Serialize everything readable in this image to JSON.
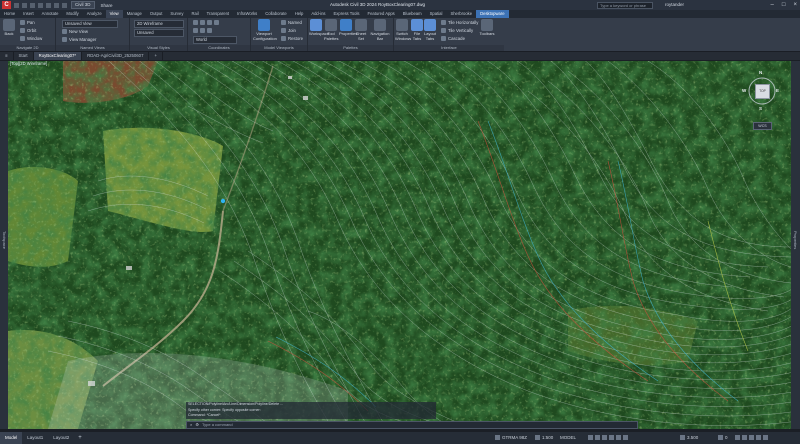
{
  "app": {
    "title": "Autodesk Civil 3D 2024   RoyBoxClearing07.dwg",
    "logo": "C",
    "workspace": "Civil 3D",
    "share_label": "Share",
    "search_placeholder": "Type a keyword or phrase",
    "user": "roytander"
  },
  "ribbon_tabs": [
    "Home",
    "Insert",
    "Annotate",
    "Modify",
    "Analyze",
    "View",
    "Manage",
    "Output",
    "Survey",
    "Rail",
    "Transparent",
    "InfraWorks",
    "Collaborate",
    "Help",
    "Add-ins",
    "Express Tools",
    "Featured Apps",
    "Bluebeam",
    "Spatial",
    "Sherbrooke",
    "Desktopware"
  ],
  "ribbon_active_tab": "View",
  "ribbon": {
    "nav": {
      "back_label": "Back",
      "pan": "Pan",
      "orbit": "Orbit",
      "window": "Window",
      "label": "Navigate 2D"
    },
    "views": {
      "unsaved_view": "Unsaved View",
      "new_view": "New View",
      "view_manager": "View Manager",
      "label": "Named Views"
    },
    "visual": {
      "style": "2D Wireframe",
      "unsaved": "Unsaved",
      "label": "Visual Styles"
    },
    "coords": {
      "world": "World",
      "label": "Coordinates"
    },
    "model_vp": {
      "config": "Viewport Configuration",
      "named": "Named",
      "join": "Join",
      "restore": "Restore",
      "label": "Model Viewports"
    },
    "palettes": {
      "workspace": "Workspace",
      "tool_palettes": "Tool Palettes",
      "properties": "Properties",
      "sheet_set": "Sheet Set",
      "layer": "Layer",
      "navigation_bar": "Navigation Bar",
      "label": "Palettes"
    },
    "interface": {
      "switch_windows": "Switch Windows",
      "file_tabs": "File Tabs",
      "layout_tabs": "Layout Tabs",
      "tile_h": "Tile Horizontally",
      "tile_v": "Tile Vertically",
      "cascade": "Cascade",
      "toolbars": "Toolbars",
      "label": "Interface"
    }
  },
  "doc_tabs": [
    {
      "label": "Start",
      "active": false
    },
    {
      "label": "RoyBoxClearing07*",
      "active": true
    },
    {
      "label": "RDAD-AgriCivil3D_25250607",
      "active": false
    }
  ],
  "viewport": {
    "label": "[Top][2D Wireframe]",
    "compass": {
      "n": "N",
      "s": "S",
      "e": "E",
      "w": "W",
      "top": "TOP"
    },
    "wcs": "WCS",
    "left_palette": "Toolspace",
    "right_palette": "Properties"
  },
  "command_history": [
    "SELECTION/Polyline/Arc/Line/Dimension/Polyline/Delete ...",
    "Specify other corner:  Specify opposite corner:",
    "Command: *Cancel*"
  ],
  "command_prompt": "Type a command",
  "layout_tabs": [
    {
      "label": "Model",
      "active": true
    },
    {
      "label": "Layout1",
      "active": false
    },
    {
      "label": "Layout2",
      "active": false
    }
  ],
  "status": {
    "coord": "GTRMA 98Z",
    "scale": "1:500",
    "model": "MODEL",
    "zoom": "3.500",
    "elevation": "0"
  }
}
